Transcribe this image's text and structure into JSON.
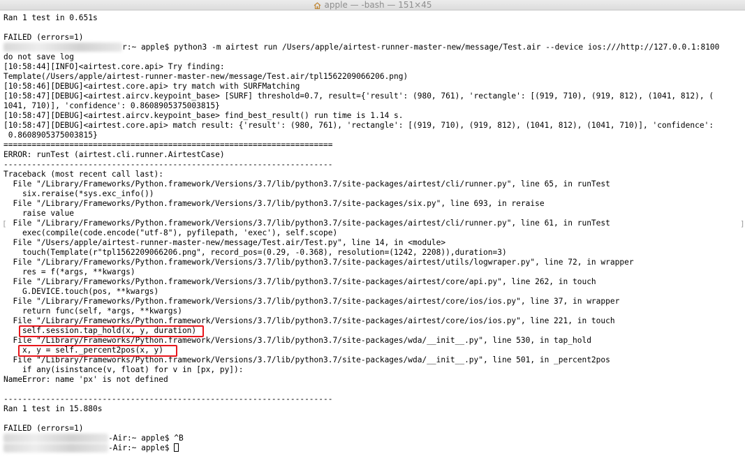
{
  "window": {
    "title": "apple — -bash — 151×45",
    "icon": "house-icon"
  },
  "terminal": {
    "prompt_blur_width": [
      170,
      150,
      150
    ],
    "lines": [
      "Ran 1 test in 0.651s",
      "",
      "FAILED (errors=1)",
      "r:~ apple$ python3 -m airtest run /Users/apple/airtest-runner-master-new/message/Test.air --device ios:///http://127.0.0.1:8100",
      "do not save log",
      "[10:58:44][INFO]<airtest.core.api> Try finding:",
      "Template(/Users/apple/airtest-runner-master-new/message/Test.air/tpl1562209066206.png)",
      "[10:58:46][DEBUG]<airtest.core.api> try match with SURFMatching",
      "[10:58:47][DEBUG]<airtest.aircv.keypoint_base> [SURF] threshold=0.7, result={'result': (980, 761), 'rectangle': [(919, 710), (919, 812), (1041, 812), (",
      "1041, 710)], 'confidence': 0.8608905375003815}",
      "[10:58:47][DEBUG]<airtest.aircv.keypoint_base> find_best_result() run time is 1.14 s.",
      "[10:58:47][DEBUG]<airtest.core.api> match result: {'result': (980, 761), 'rectangle': [(919, 710), (919, 812), (1041, 812), (1041, 710)], 'confidence':",
      " 0.8608905375003815}",
      "======================================================================",
      "ERROR: runTest (airtest.cli.runner.AirtestCase)",
      "----------------------------------------------------------------------",
      "Traceback (most recent call last):",
      "  File \"/Library/Frameworks/Python.framework/Versions/3.7/lib/python3.7/site-packages/airtest/cli/runner.py\", line 65, in runTest",
      "    six.reraise(*sys.exc_info())",
      "  File \"/Library/Frameworks/Python.framework/Versions/3.7/lib/python3.7/site-packages/six.py\", line 693, in reraise",
      "    raise value",
      "  File \"/Library/Frameworks/Python.framework/Versions/3.7/lib/python3.7/site-packages/airtest/cli/runner.py\", line 61, in runTest",
      "    exec(compile(code.encode(\"utf-8\"), pyfilepath, 'exec'), self.scope)",
      "  File \"/Users/apple/airtest-runner-master-new/message/Test.air/Test.py\", line 14, in <module>",
      "    touch(Template(r\"tpl1562209066206.png\", record_pos=(0.29, -0.368), resolution=(1242, 2208)),duration=3)",
      "  File \"/Library/Frameworks/Python.framework/Versions/3.7/lib/python3.7/site-packages/airtest/utils/logwraper.py\", line 72, in wrapper",
      "    res = f(*args, **kwargs)",
      "  File \"/Library/Frameworks/Python.framework/Versions/3.7/lib/python3.7/site-packages/airtest/core/api.py\", line 262, in touch",
      "    G.DEVICE.touch(pos, **kwargs)",
      "  File \"/Library/Frameworks/Python.framework/Versions/3.7/lib/python3.7/site-packages/airtest/core/ios/ios.py\", line 37, in wrapper",
      "    return func(self, *args, **kwargs)",
      "  File \"/Library/Frameworks/Python.framework/Versions/3.7/lib/python3.7/site-packages/airtest/core/ios/ios.py\", line 221, in touch",
      "    self.session.tap_hold(x, y, duration)",
      "  File \"/Library/Frameworks/Python.framework/Versions/3.7/lib/python3.7/site-packages/wda/__init__.py\", line 530, in tap_hold",
      "    x, y = self._percent2pos(x, y)",
      "  File \"/Library/Frameworks/Python.framework/Versions/3.7/lib/python3.7/site-packages/wda/__init__.py\", line 501, in _percent2pos",
      "    if any(isinstance(v, float) for v in [px, py]):",
      "NameError: name 'px' is not defined",
      "",
      "----------------------------------------------------------------------",
      "Ran 1 test in 15.880s",
      "",
      "FAILED (errors=1)",
      "-Air:~ apple$ ^B",
      "-Air:~ apple$ "
    ]
  },
  "highlight": {
    "color": "#e8151b"
  }
}
